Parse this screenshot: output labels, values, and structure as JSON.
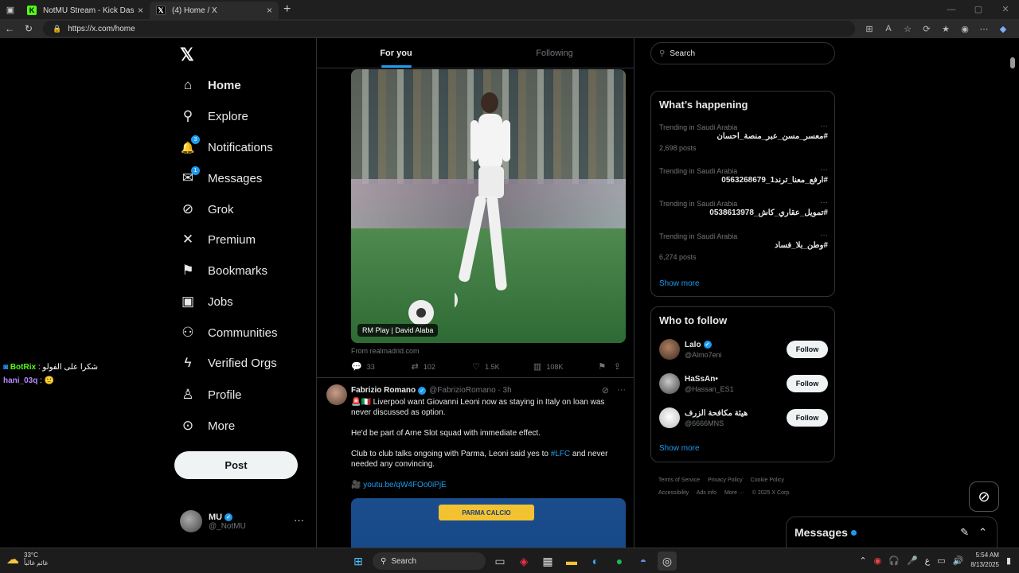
{
  "browser": {
    "tabs": [
      {
        "label": "NotMU Stream - Kick Dashboard",
        "favicon": "K",
        "active": false
      },
      {
        "label": "(4) Home / X",
        "favicon": "𝕏",
        "active": true
      }
    ],
    "url": "https://x.com/home"
  },
  "chat": [
    {
      "user": "BotRix",
      "message": "شكرا على الفولو"
    },
    {
      "user": "hani_03q",
      "message": "🙂"
    }
  ],
  "nav": {
    "items": [
      {
        "label": "Home",
        "icon": "home-icon",
        "glyph": "⌂"
      },
      {
        "label": "Explore",
        "icon": "search-icon",
        "glyph": "⚲"
      },
      {
        "label": "Notifications",
        "icon": "bell-icon",
        "glyph": "🔔",
        "badge": "3"
      },
      {
        "label": "Messages",
        "icon": "envelope-icon",
        "glyph": "✉",
        "badge": "1"
      },
      {
        "label": "Grok",
        "icon": "grok-icon",
        "glyph": "⊘"
      },
      {
        "label": "Premium",
        "icon": "x-icon",
        "glyph": "✕"
      },
      {
        "label": "Bookmarks",
        "icon": "bookmark-icon",
        "glyph": "⚑"
      },
      {
        "label": "Jobs",
        "icon": "briefcase-icon",
        "glyph": "▣"
      },
      {
        "label": "Communities",
        "icon": "people-icon",
        "glyph": "⚇"
      },
      {
        "label": "Verified Orgs",
        "icon": "lightning-icon",
        "glyph": "ϟ"
      },
      {
        "label": "Profile",
        "icon": "person-icon",
        "glyph": "♙"
      },
      {
        "label": "More",
        "icon": "more-circle-icon",
        "glyph": "⊙"
      }
    ],
    "post_label": "Post",
    "account": {
      "name": "MU",
      "handle": "@_NotMU"
    }
  },
  "feed": {
    "tabs": [
      "For you",
      "Following"
    ],
    "tweet1": {
      "media_caption": "RM Play | David Alaba",
      "source": "From realmadrid.com",
      "replies": "33",
      "reposts": "102",
      "likes": "1.5K",
      "views": "108K"
    },
    "tweet2": {
      "name": "Fabrizio Romano",
      "handle": "@FabrizioRomano · 3h",
      "line1": "🚨🇮🇹 Liverpool want Giovanni Leoni now as staying in Italy on loan was never discussed as option.",
      "line2": "He'd be part of Arne Slot squad with immediate effect.",
      "line3a": "Club to club talks ongoing with Parma, Leoni said yes to ",
      "line3_link": "#LFC",
      "line3b": " and never needed any convincing.",
      "link": "youtu.be/qW4FOo0iPjE",
      "media_sign": "PARMA CALCIO"
    }
  },
  "sidebar": {
    "search_placeholder": "Search",
    "trending_title": "What’s happening",
    "trends": [
      {
        "context": "Trending in Saudi Arabia",
        "tag": "#معسر_مسن_عبر_منصة_احسان",
        "count": "2,698 posts"
      },
      {
        "context": "Trending in Saudi Arabia",
        "tag": "#ارفع_معنا_ترند1_0563268679",
        "count": ""
      },
      {
        "context": "Trending in Saudi Arabia",
        "tag": "#تمويل_عقاري_كاش_0538613978",
        "count": ""
      },
      {
        "context": "Trending in Saudi Arabia",
        "tag": "#وطن_بلا_فساد",
        "count": "6,274 posts"
      }
    ],
    "show_more": "Show more",
    "who_title": "Who to follow",
    "follows": [
      {
        "name": "Lalo",
        "handle": "@Almo7eni",
        "verified": true,
        "btn": "Follow"
      },
      {
        "name": "HaSsAn•",
        "handle": "@Hassan_ES1",
        "verified": false,
        "btn": "Follow"
      },
      {
        "name": "هيئة مكافحة الزرف",
        "handle": "@6666MNS",
        "verified": false,
        "btn": "Follow"
      }
    ],
    "footer": [
      "Terms of Service",
      "Privacy Policy",
      "Cookie Policy",
      "Accessibility",
      "Ads info",
      "More ···",
      "© 2025 X Corp."
    ]
  },
  "messages_drawer": {
    "title": "Messages"
  },
  "taskbar": {
    "temp": "33°C",
    "weather_text": "غائم غالباً",
    "search": "Search",
    "lang": "ع",
    "time": "5:54 AM",
    "date": "8/13/2025"
  },
  "colors": {
    "accent": "#1d9bf0",
    "kick_green": "#53fc18"
  }
}
